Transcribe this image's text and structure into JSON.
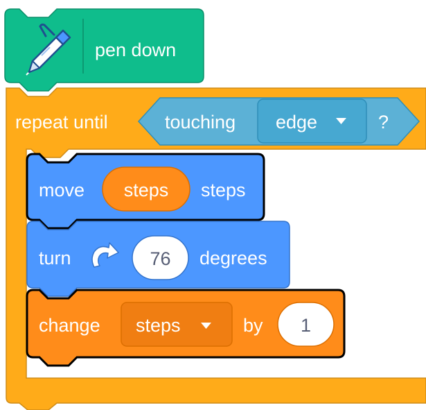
{
  "blocks": {
    "pen_down": {
      "label": "pen down",
      "icon": "pen-icon",
      "color": "#0FBD8C",
      "border": "#0B8E69"
    },
    "repeat_until": {
      "label": "repeat until",
      "color": "#FFAB19",
      "border": "#CF8B17",
      "condition": {
        "label": "touching",
        "dropdown_value": "edge",
        "suffix": "?",
        "color": "#5CB1D6",
        "border": "#2E8EB8"
      }
    },
    "move": {
      "prefix": "move",
      "reporter_label": "steps",
      "suffix": "steps",
      "color": "#4C97FF",
      "border": "#3373CC",
      "reporter_color": "#FF8C1A"
    },
    "turn": {
      "prefix": "turn",
      "icon": "rotate-right-icon",
      "value": "76",
      "suffix": "degrees",
      "color": "#4C97FF",
      "border": "#3373CC"
    },
    "change": {
      "prefix": "change",
      "dropdown_value": "steps",
      "middle": "by",
      "value": "1",
      "color": "#FF8C1A",
      "border": "#DB6E00"
    }
  }
}
